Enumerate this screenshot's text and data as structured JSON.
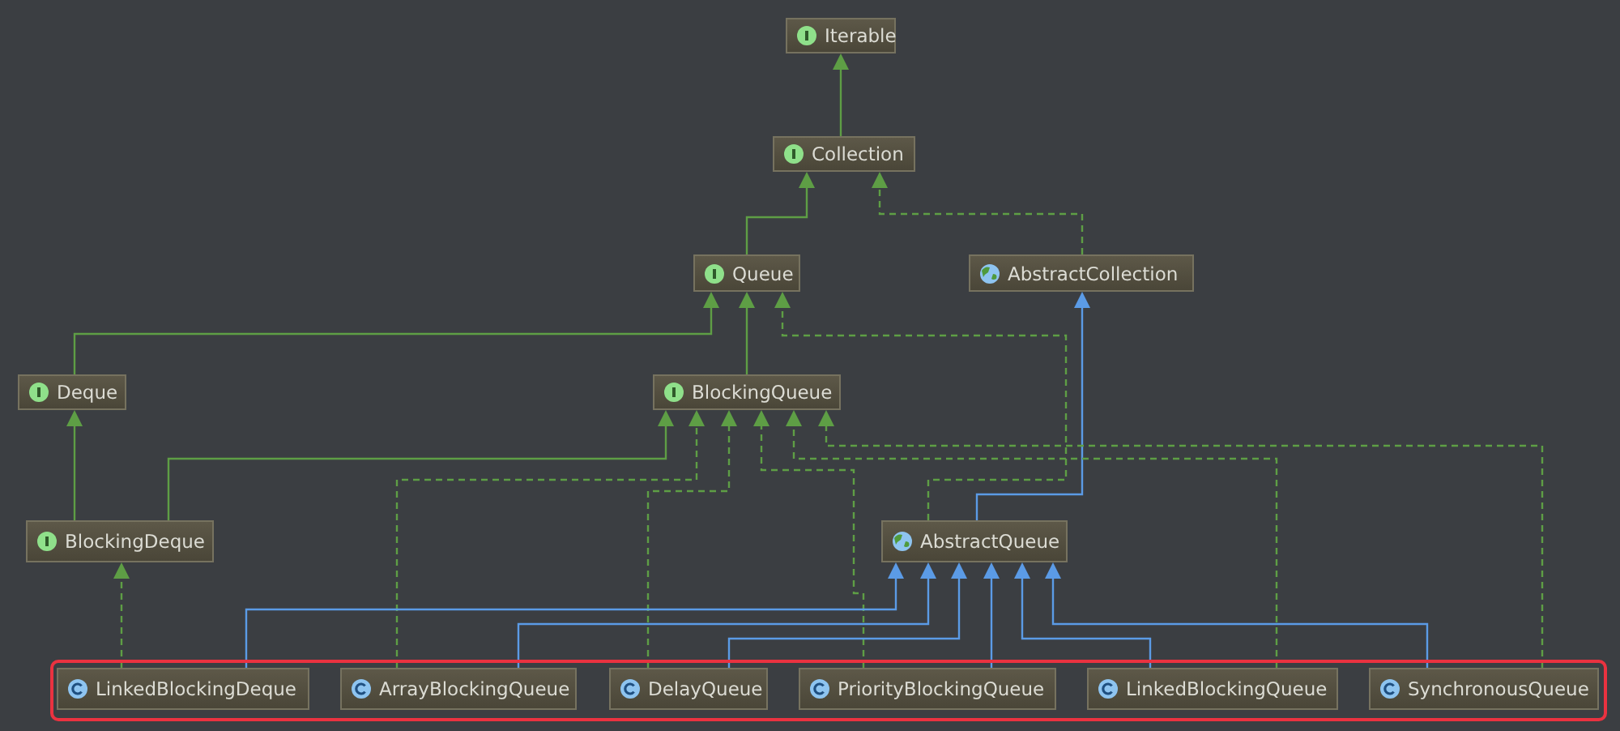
{
  "diagram": {
    "nodes": [
      {
        "name": "Iterable",
        "kind": "interface"
      },
      {
        "name": "Collection",
        "kind": "interface"
      },
      {
        "name": "Queue",
        "kind": "interface"
      },
      {
        "name": "AbstractCollection",
        "kind": "abstract"
      },
      {
        "name": "Deque",
        "kind": "interface"
      },
      {
        "name": "BlockingQueue",
        "kind": "interface"
      },
      {
        "name": "BlockingDeque",
        "kind": "interface"
      },
      {
        "name": "AbstractQueue",
        "kind": "abstract"
      },
      {
        "name": "LinkedBlockingDeque",
        "kind": "class"
      },
      {
        "name": "ArrayBlockingQueue",
        "kind": "class"
      },
      {
        "name": "DelayQueue",
        "kind": "class"
      },
      {
        "name": "PriorityBlockingQueue",
        "kind": "class"
      },
      {
        "name": "LinkedBlockingQueue",
        "kind": "class"
      },
      {
        "name": "SynchronousQueue",
        "kind": "class"
      }
    ],
    "connectors": [
      {
        "kind": "interface-extends"
      },
      {
        "kind": "interface-extends"
      },
      {
        "kind": "implements"
      },
      {
        "kind": "interface-extends"
      },
      {
        "kind": "interface-extends"
      },
      {
        "kind": "implements"
      },
      {
        "kind": "class-extends"
      },
      {
        "kind": "interface-extends"
      },
      {
        "kind": "interface-extends"
      },
      {
        "kind": "implements"
      },
      {
        "kind": "implements"
      },
      {
        "kind": "implements"
      },
      {
        "kind": "implements"
      },
      {
        "kind": "implements"
      },
      {
        "kind": "implements"
      },
      {
        "kind": "class-extends"
      },
      {
        "kind": "class-extends"
      },
      {
        "kind": "class-extends"
      },
      {
        "kind": "class-extends"
      },
      {
        "kind": "class-extends"
      },
      {
        "kind": "class-extends"
      }
    ],
    "highlight_frame": true
  }
}
